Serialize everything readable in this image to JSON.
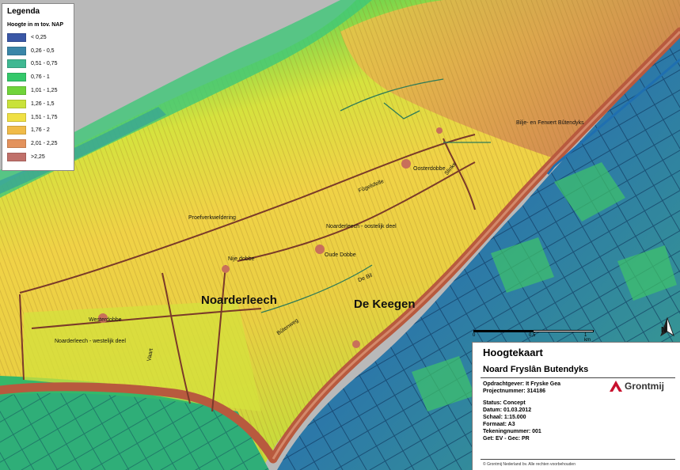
{
  "legend": {
    "title": "Legenda",
    "subtitle": "Hoogte in m tov. NAP",
    "classes": [
      {
        "label": "< 0,25",
        "color": "#3a57a6"
      },
      {
        "label": "0,26 - 0,5",
        "color": "#3a86a8"
      },
      {
        "label": "0,51 - 0,75",
        "color": "#3fb892"
      },
      {
        "label": "0,76 - 1",
        "color": "#34c86a"
      },
      {
        "label": "1,01 - 1,25",
        "color": "#70d43a"
      },
      {
        "label": "1,26 - 1,5",
        "color": "#c9e23a"
      },
      {
        "label": "1,51 - 1,75",
        "color": "#f0e044"
      },
      {
        "label": "1,76 - 2",
        "color": "#f0bb48"
      },
      {
        "label": "2,01 - 2,25",
        "color": "#e3925c"
      },
      {
        "label": ">2,25",
        "color": "#c0706a"
      }
    ]
  },
  "map_labels": {
    "bilje": "Bilje- en Ferwert Bûtendyks",
    "oosterdobbe": "Oosterdobbe",
    "proefverkweldering": "Proefverkweldering",
    "noarderleech_oost": "Noarderleech - oostelijk deel",
    "nije_dobbe": "Nije dobbe",
    "oude_dobbe": "Oude Dobbe",
    "de_bil": "De Bil",
    "noarderleech": "Noarderleech",
    "de_keegen": "De Keegen",
    "westerdobbe": "Westerdobbe",
    "noarderleech_west": "Noarderleech - westelijk deel",
    "road_a": "Fûgelsfelle",
    "road_b": "Bûtenweg",
    "road_c": "Vaart",
    "road_d": "Slinke"
  },
  "scalebar": {
    "ticks": [
      "0",
      "0,5",
      "1 km"
    ]
  },
  "north": {
    "label": "N"
  },
  "titleblock": {
    "title": "Hoogtekaart",
    "subtitle": "Noard Fryslân Butendyks",
    "client": "Opdrachtgever: It Fryske Gea",
    "project": "Projectnummer: 314186",
    "status": "Status: Concept",
    "date": "Datum: 01.03.2012",
    "scale": "Schaal: 1:15.000",
    "format": "Formaat: A3",
    "drawing": "Tekeningnummer: 001",
    "drawn": "Get: EV - Gec: PR",
    "logo_text": "Grontmij",
    "footer": "© Grontmij Nederland bv. Alle rechten voorbehouden"
  },
  "colors": {
    "sea": "#b9b9b9",
    "dike": "#b85a3e",
    "water": "#1f6fb0"
  }
}
